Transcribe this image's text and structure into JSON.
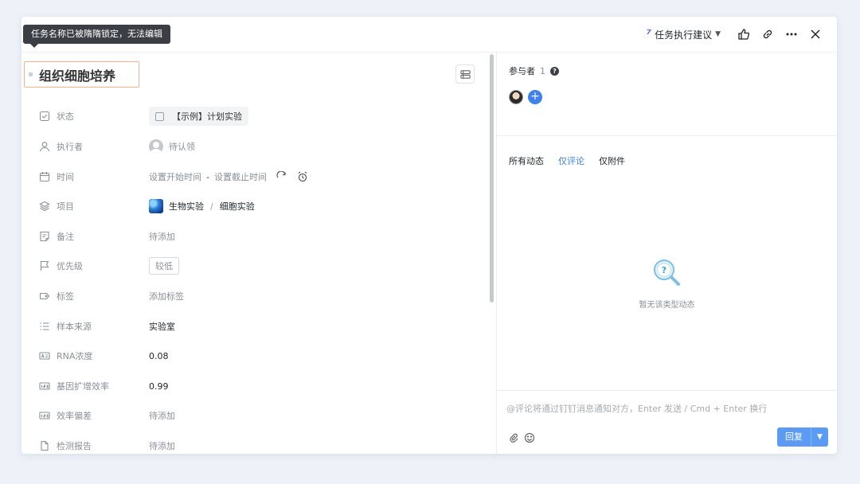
{
  "tooltip": "任务名称已被隋隋锁定，无法编辑",
  "toolbar": {
    "suggest_label": "任务执行建议",
    "icons": [
      "spark-icon",
      "chevron-down-icon",
      "thumbs-up-icon",
      "link-icon",
      "more-icon",
      "close-icon"
    ]
  },
  "task": {
    "title": "组织细胞培养"
  },
  "fields": [
    {
      "icon": "checkbox-icon",
      "label": "状态",
      "value": "【示例】计划实验"
    },
    {
      "icon": "person-icon",
      "label": "执行者",
      "value": "待认领"
    },
    {
      "icon": "calendar-icon",
      "label": "时间",
      "start": "设置开始时间",
      "dash": "-",
      "end": "设置截止时间"
    },
    {
      "icon": "layers-icon",
      "label": "项目",
      "project": "生物实验",
      "sub": "细胞实验",
      "divider": "/"
    },
    {
      "icon": "note-icon",
      "label": "备注",
      "value": "待添加"
    },
    {
      "icon": "flag-icon",
      "label": "优先级",
      "value": "较低"
    },
    {
      "icon": "tag-icon",
      "label": "标签",
      "value": "添加标签"
    },
    {
      "icon": "list-icon",
      "label": "样本来源",
      "value": "实验室"
    },
    {
      "icon": "text-field-icon",
      "label": "RNA浓度",
      "value": "0.08"
    },
    {
      "icon": "number-field-icon",
      "label": "基因扩增效率",
      "value": "0.99"
    },
    {
      "icon": "number-field-icon",
      "label": "效率偏差",
      "value": "待添加"
    },
    {
      "icon": "file-icon",
      "label": "检测报告",
      "value": "待添加"
    }
  ],
  "participants": {
    "label": "参与者",
    "count": "1",
    "help": "?"
  },
  "activity": {
    "tabs": [
      "所有动态",
      "仅评论",
      "仅附件"
    ],
    "active_tab": 1,
    "empty_text": "暂无该类型动态",
    "empty_glyph": "?"
  },
  "composer": {
    "placeholder": "@评论将通过钉钉消息通知对方，Enter 发送 / Cmd + Enter 换行",
    "reply_label": "回复"
  },
  "colors": {
    "accent": "#3d82f0",
    "reply_button": "#5b9bf4",
    "title_border": "#f5b48a",
    "tooltip_bg": "#3b3f45",
    "page_bg": "#eef2f8"
  }
}
